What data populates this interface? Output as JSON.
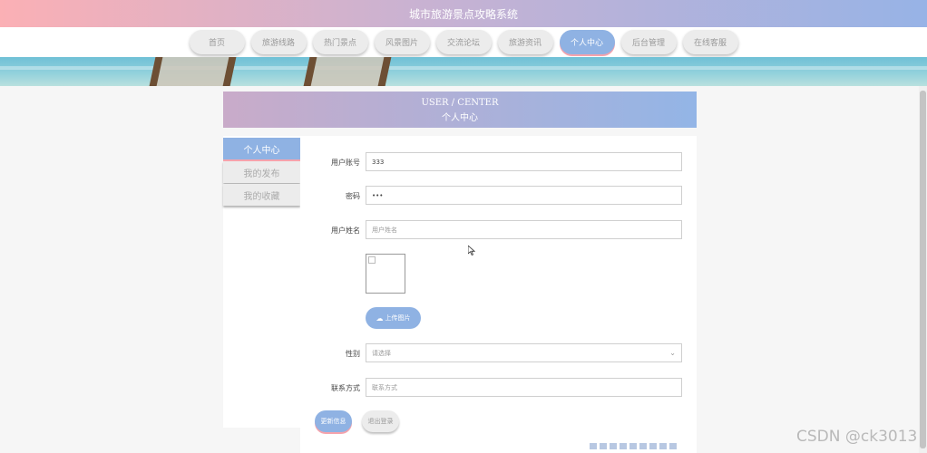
{
  "header": {
    "site_title": "城市旅游景点攻略系统"
  },
  "nav": {
    "items": [
      "首页",
      "旅游线路",
      "热门景点",
      "风景图片",
      "交流论坛",
      "旅游资讯",
      "个人中心",
      "后台管理",
      "在线客服"
    ],
    "active_index": 6
  },
  "center": {
    "title_en": "USER / CENTER",
    "title_cn": "个人中心"
  },
  "sidebar": {
    "items": [
      "个人中心",
      "我的发布",
      "我的收藏"
    ],
    "active_index": 0
  },
  "form": {
    "account": {
      "label": "用户账号",
      "value": "333"
    },
    "password": {
      "label": "密码",
      "value": "•••"
    },
    "name": {
      "label": "用户姓名",
      "placeholder": "用户姓名"
    },
    "upload_label": "上传图片",
    "gender": {
      "label": "性别",
      "placeholder": "请选择"
    },
    "contact": {
      "label": "联系方式",
      "placeholder": "联系方式"
    },
    "update_label": "更新信息",
    "logout_label": "退出登录"
  },
  "watermark": "CSDN @ck3013",
  "colors": {
    "accent": "#8fb2e3",
    "accent_shadow": "#f6a3ac",
    "header_gradient_start": "#fbb0b5",
    "header_gradient_end": "#97b3e6"
  }
}
